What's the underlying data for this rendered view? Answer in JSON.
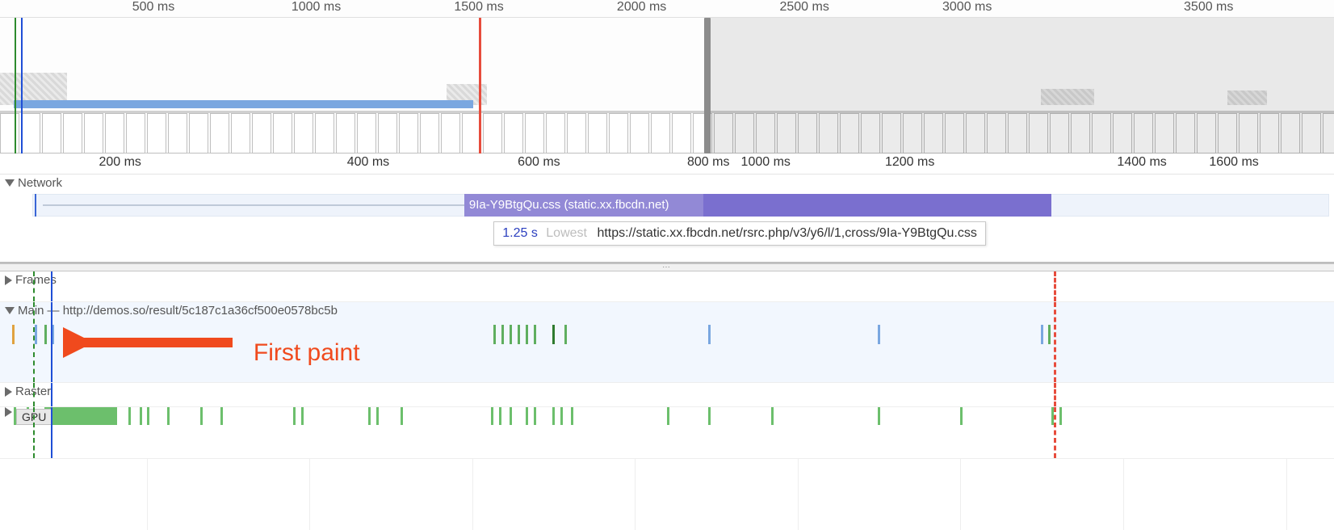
{
  "overview": {
    "ticks": [
      {
        "label": "500 ms",
        "pct": 11.5
      },
      {
        "label": "1000 ms",
        "pct": 23.7
      },
      {
        "label": "1500 ms",
        "pct": 35.9
      },
      {
        "label": "2000 ms",
        "pct": 48.1
      },
      {
        "label": "2500 ms",
        "pct": 60.3
      },
      {
        "label": "3000 ms",
        "pct": 72.5
      },
      {
        "label": "3500 ms",
        "pct": 90.6
      }
    ],
    "selection_start_pct": 0,
    "selection_end_pct": 53.2,
    "red_marker_pct": 35.9,
    "green_marker_pct": 1.1,
    "blue_marker_pct": 1.6
  },
  "detail_ruler": {
    "ticks": [
      {
        "label": "200 ms",
        "pct": 9.0
      },
      {
        "label": "400 ms",
        "pct": 27.6
      },
      {
        "label": "600 ms",
        "pct": 40.4
      },
      {
        "label": "800 ms",
        "pct": 53.1
      },
      {
        "label": "1000 ms",
        "pct": 57.4
      },
      {
        "label": "1200 ms",
        "pct": 68.2
      },
      {
        "label": "1400 ms",
        "pct": 85.6
      },
      {
        "label": "1600 ms",
        "pct": 92.5
      }
    ]
  },
  "detail_markers": {
    "red_dashed_pct": 79.0,
    "blue_pcts": [
      3.8
    ],
    "green_dashed_pcts": [
      2.5
    ]
  },
  "tracks": {
    "network": {
      "label": "Network",
      "request_bar": {
        "start_pct": 34.8,
        "width_pct": 44.0,
        "dark_start_pct": 52.7,
        "dark_width_pct": 26.1,
        "label": "9Ia-Y9BtgQu.css (static.xx.fbcdn.net)"
      },
      "waiting_line": {
        "start_pct": 3.2,
        "width_pct": 31.6
      },
      "start_tick_pct": 2.6,
      "tooltip": {
        "left_pct": 37.0,
        "duration": "1.25 s",
        "priority": "Lowest",
        "url": "https://static.xx.fbcdn.net/rsrc.php/v3/y6/l/1,cross/9Ia-Y9BtgQu.css"
      }
    },
    "frames": {
      "label": "Frames"
    },
    "main": {
      "label": "Main",
      "url": "http://demos.so/result/5c187c1a36cf500e0578bc5b",
      "annotation_text": "First paint",
      "flames": [
        {
          "color": "orange",
          "pct": 0.9
        },
        {
          "color": "blue",
          "pct": 2.6
        },
        {
          "color": "green",
          "pct": 3.3
        },
        {
          "color": "blue",
          "pct": 3.9
        },
        {
          "color": "green",
          "pct": 37.0
        },
        {
          "color": "green",
          "pct": 37.6
        },
        {
          "color": "green",
          "pct": 38.2
        },
        {
          "color": "green",
          "pct": 38.8
        },
        {
          "color": "green",
          "pct": 39.4
        },
        {
          "color": "green",
          "pct": 40.0
        },
        {
          "color": "dkgreen",
          "pct": 41.4
        },
        {
          "color": "green",
          "pct": 42.3
        },
        {
          "color": "blue",
          "pct": 53.1
        },
        {
          "color": "blue",
          "pct": 65.8
        },
        {
          "color": "blue",
          "pct": 78.0
        },
        {
          "color": "green",
          "pct": 78.6
        }
      ]
    },
    "raster": {
      "label": "Raster"
    },
    "gpu": {
      "label": "GPU",
      "big_block": {
        "start_pct": 3.3,
        "width_pct": 5.5
      },
      "ticks_pct": [
        1.0,
        2.0,
        9.6,
        10.5,
        11.0,
        12.5,
        15.0,
        16.5,
        22.0,
        22.6,
        27.6,
        28.2,
        30.0,
        36.8,
        37.4,
        38.2,
        39.4,
        40.0,
        41.4,
        42.0,
        42.8,
        50.0,
        53.1,
        57.8,
        65.8,
        72.0,
        78.8,
        79.4
      ]
    }
  },
  "splitter_dots": "⋯"
}
